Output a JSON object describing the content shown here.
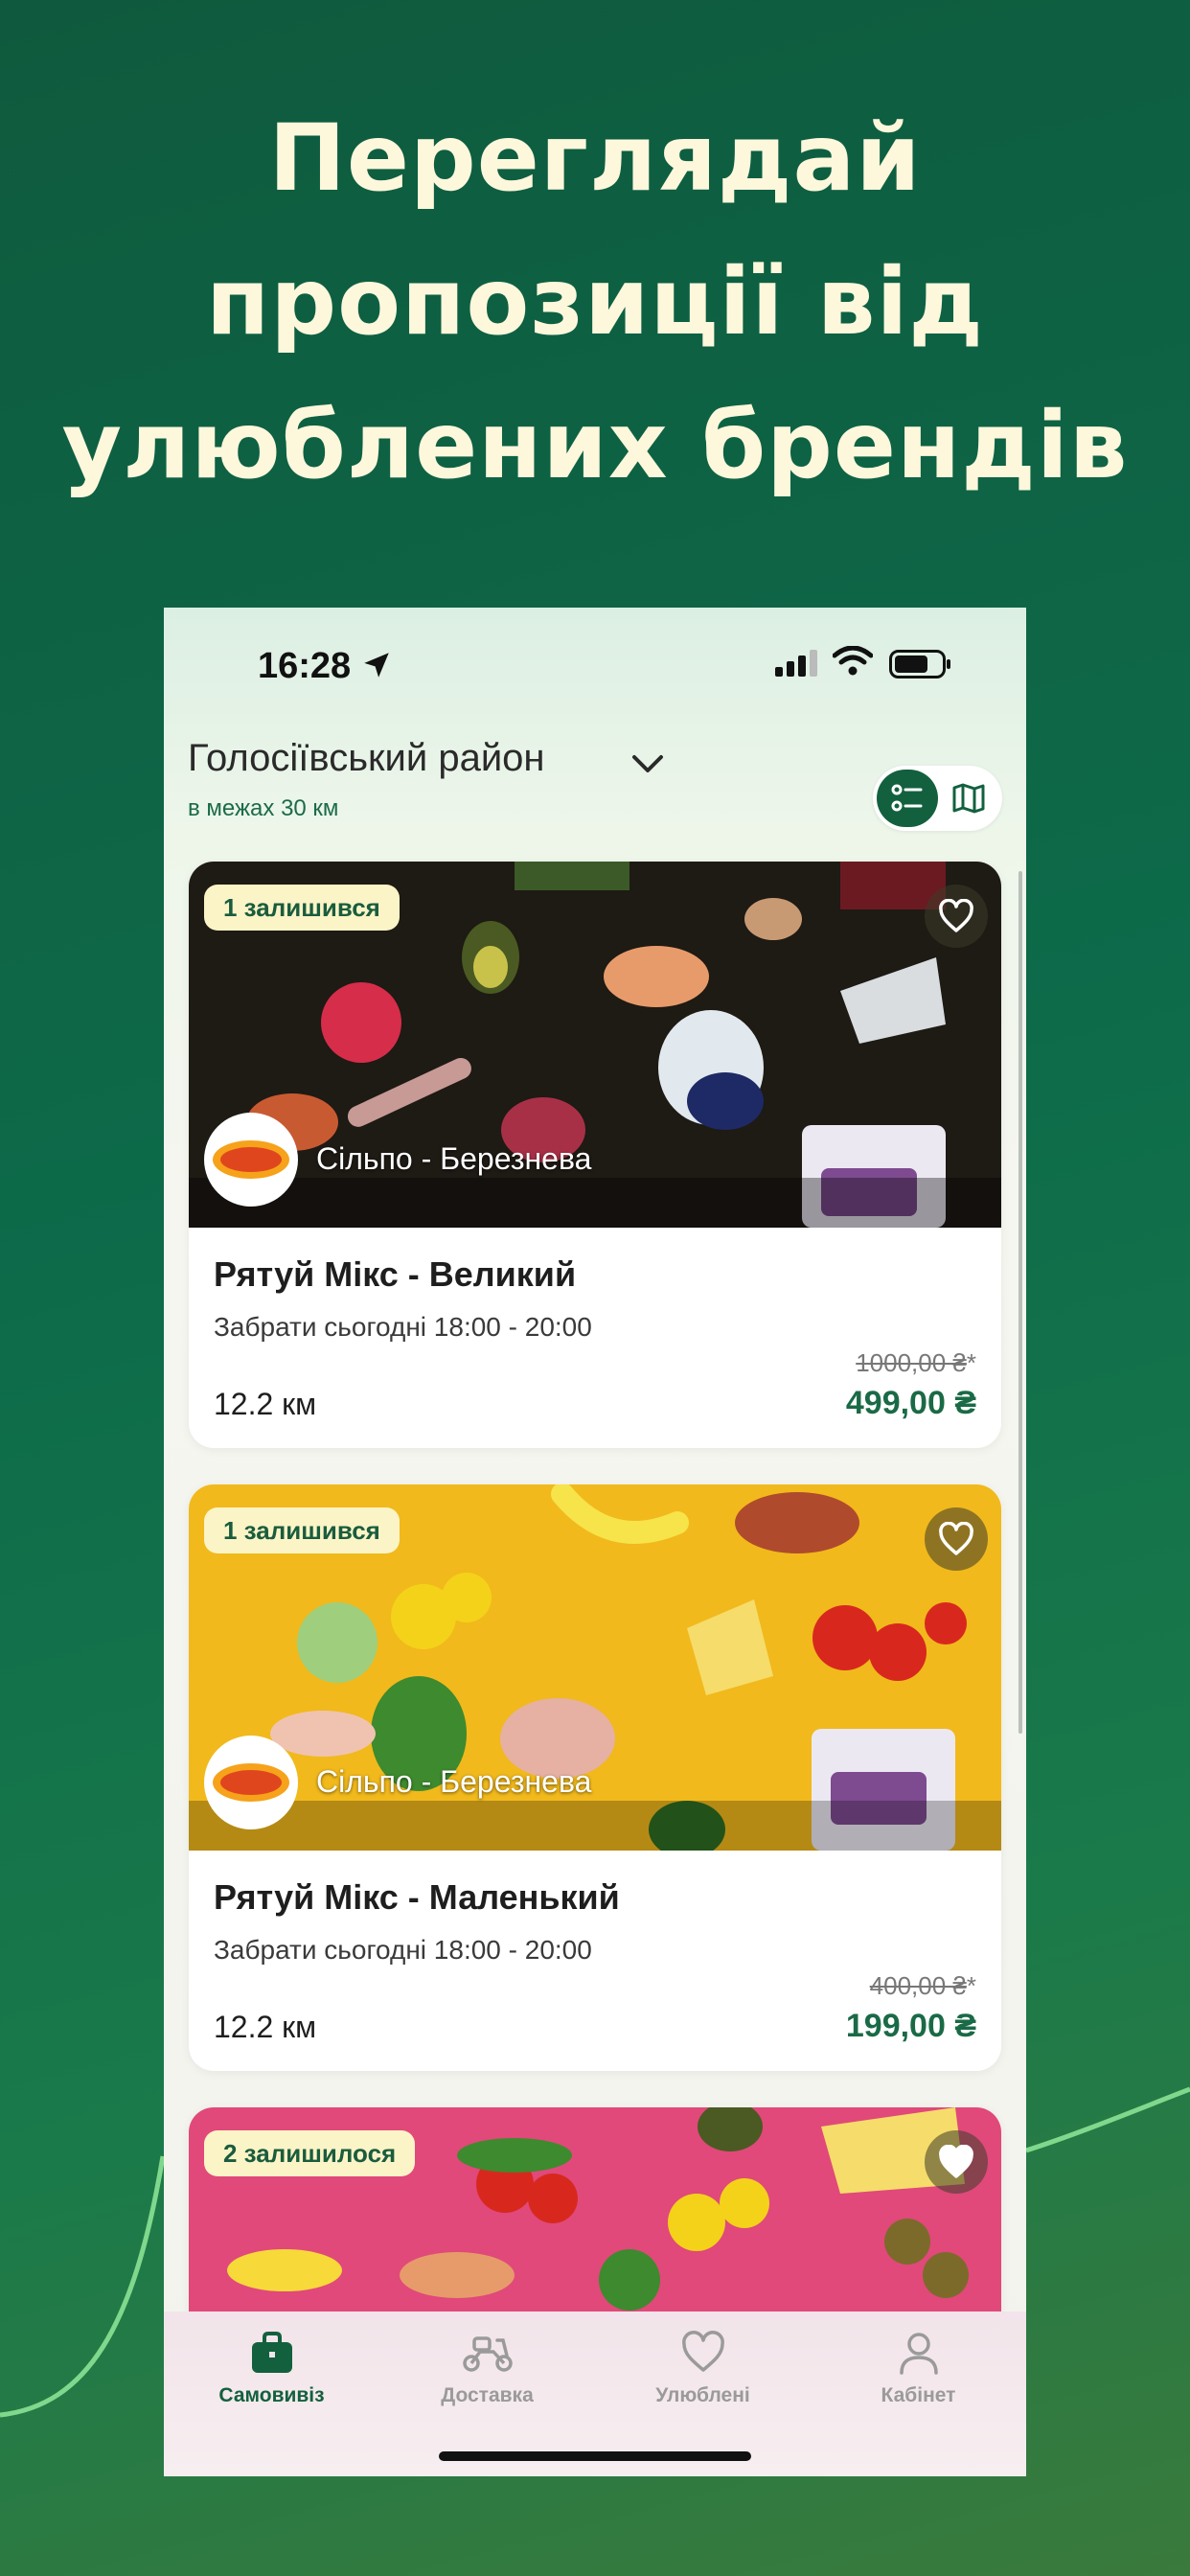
{
  "headline": {
    "line1": "Переглядай",
    "line2": "пропозиції від",
    "line3": "улюблених брендів"
  },
  "colors": {
    "brand_green": "#13603f",
    "price_green": "#1a6a46",
    "badge_bg": "#fbf4c6",
    "headline_text": "#fdf7dc"
  },
  "status_bar": {
    "time": "16:28"
  },
  "location": {
    "district": "Голосіївський район",
    "radius": "в межах 30 км"
  },
  "view_toggle": {
    "list_icon": "list-icon",
    "map_icon": "map-icon",
    "selected": "list"
  },
  "cards": [
    {
      "badge": "1 залишився",
      "store": "Сільпо - Березнева",
      "title": "Рятуй Мікс - Великий",
      "pickup": "Забрати сьогодні 18:00 - 20:00",
      "distance": "12.2 км",
      "old_price": "1000,00 ₴",
      "old_price_mark": "*",
      "new_price": "499,00 ₴",
      "image_bg": "#1e1a14"
    },
    {
      "badge": "1 залишився",
      "store": "Сільпо - Березнева",
      "title": "Рятуй Мікс - Маленький",
      "pickup": "Забрати сьогодні 18:00 - 20:00",
      "distance": "12.2 км",
      "old_price": "400,00 ₴",
      "old_price_mark": "*",
      "new_price": "199,00 ₴",
      "image_bg": "#f1b91c"
    },
    {
      "badge": "2 залишилося",
      "image_bg": "#e0497a"
    }
  ],
  "tabbar": {
    "items": [
      {
        "label": "Самовивіз",
        "icon": "bag-icon",
        "active": true
      },
      {
        "label": "Доставка",
        "icon": "scooter-icon",
        "active": false
      },
      {
        "label": "Улюблені",
        "icon": "heart-icon",
        "active": false
      },
      {
        "label": "Кабінет",
        "icon": "person-icon",
        "active": false
      }
    ]
  }
}
